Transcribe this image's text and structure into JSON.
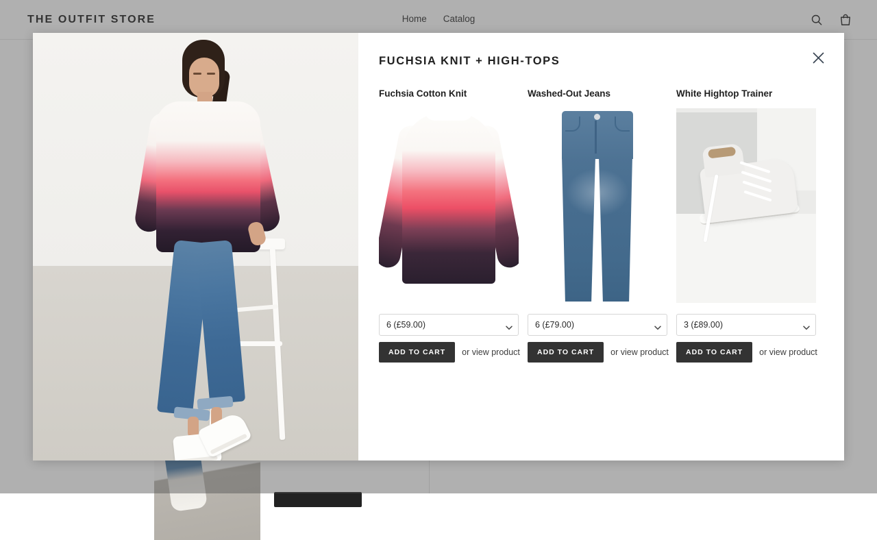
{
  "header": {
    "logo": "THE OUTFIT STORE",
    "nav": [
      {
        "label": "Home"
      },
      {
        "label": "Catalog"
      }
    ],
    "icons": [
      {
        "name": "search-icon"
      },
      {
        "name": "shopping-bag-icon"
      }
    ]
  },
  "modal": {
    "title": "FUCHSIA KNIT + HIGH-TOPS",
    "close_label": "×",
    "hero_alt": "Model seated on stool wearing fuchsia ombre knit, washed-out jeans and white hightop trainers",
    "products": [
      {
        "title": "Fuchsia Cotton Knit",
        "image_alt": "Fuchsia ombre cotton knit jumper",
        "selected_variant": "6 (£59.00)",
        "variant_options": [
          "6 (£59.00)"
        ],
        "add_label": "ADD TO CART",
        "view_label": "or view product"
      },
      {
        "title": "Washed-Out Jeans",
        "image_alt": "Washed-out blue slim jeans",
        "selected_variant": "6 (£79.00)",
        "variant_options": [
          "6 (£79.00)"
        ],
        "add_label": "ADD TO CART",
        "view_label": "or view product"
      },
      {
        "title": "White Hightop Trainer",
        "image_alt": "White leather hightop trainer with laces",
        "selected_variant": "3 (£89.00)",
        "variant_options": [
          "3 (£89.00)"
        ],
        "add_label": "ADD TO CART",
        "view_label": "or view product"
      }
    ]
  },
  "colors": {
    "button": "#333333",
    "text": "#1f1f1f",
    "border": "#d6d6d6",
    "scrim": "#999999",
    "fuchsia": "#ec4f66",
    "denim": "#4a76a0"
  }
}
